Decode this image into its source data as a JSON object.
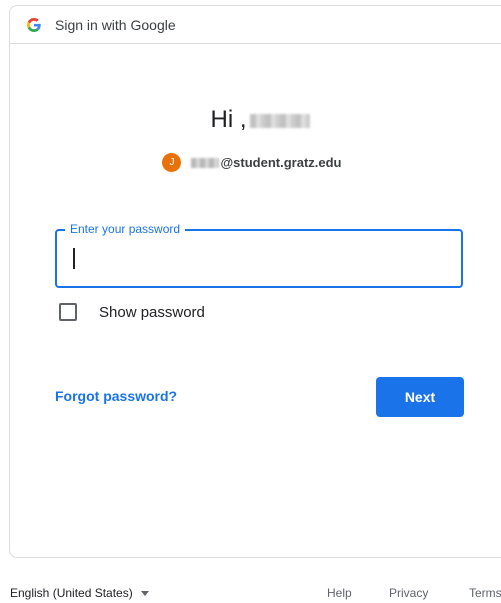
{
  "header": {
    "title": "Sign in with Google",
    "logo_icon": "google-g-icon"
  },
  "greeting": {
    "text": "Hi ,"
  },
  "account": {
    "avatar_initial": "J",
    "avatar_color": "#e8710a",
    "email_domain": "@student.gratz.edu"
  },
  "password_field": {
    "label": "Enter your password",
    "value": "",
    "accent_color": "#1a73e8"
  },
  "show_password": {
    "label": "Show password",
    "checked": false
  },
  "actions": {
    "forgot_label": "Forgot password?",
    "next_label": "Next"
  },
  "footer": {
    "language": "English (United States)",
    "links": [
      "Help",
      "Privacy",
      "Terms"
    ]
  }
}
